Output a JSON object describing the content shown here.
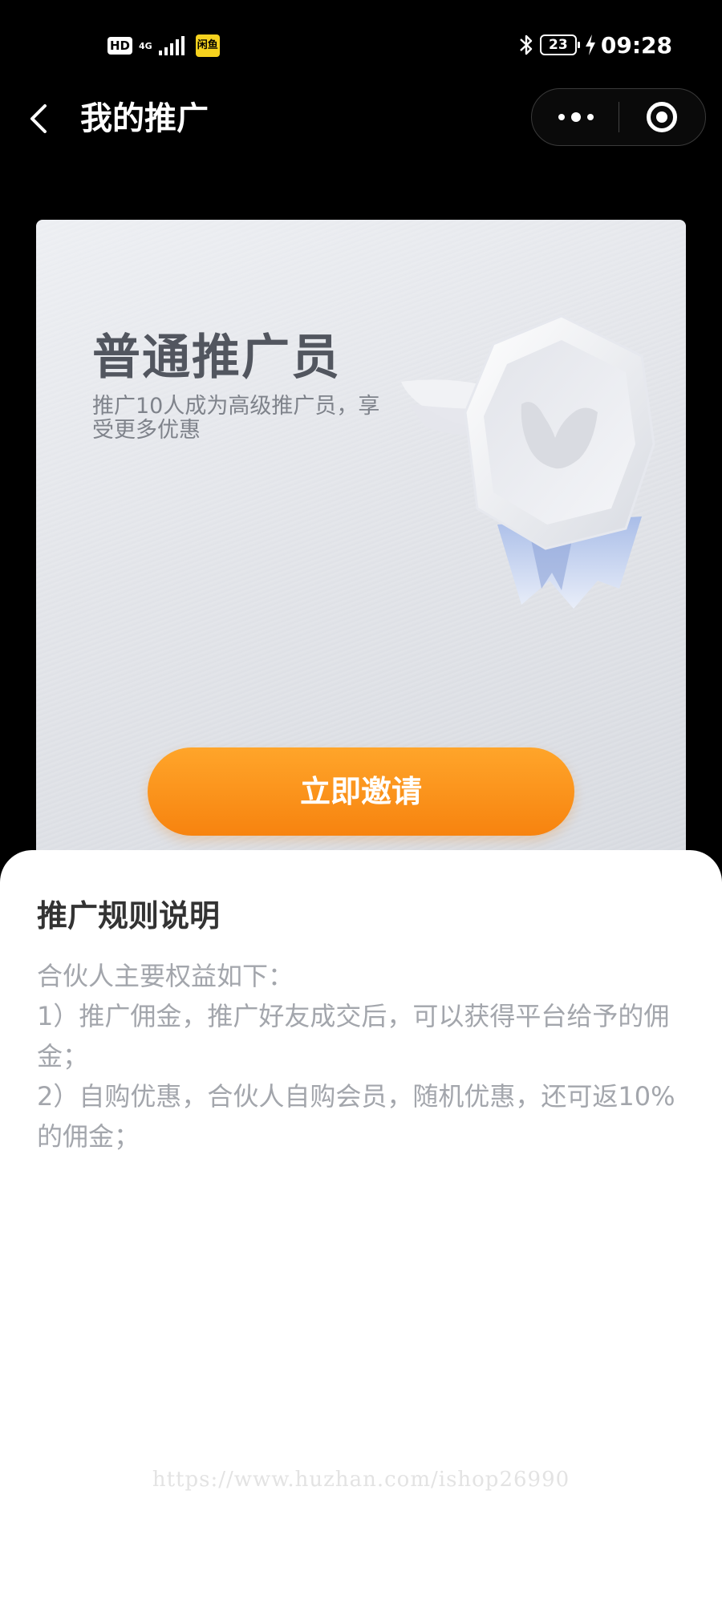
{
  "status_bar": {
    "hd": "HD",
    "network": "4G",
    "app_badge": "闲鱼",
    "battery": "23",
    "time": "09:28"
  },
  "nav": {
    "title": "我的推广"
  },
  "promo": {
    "level_title": "普通推广员",
    "level_desc": "推广10人成为高级推广员，享受更多优惠",
    "invite_label": "立即邀请"
  },
  "rules": {
    "title": "推广规则说明",
    "lines": [
      "合伙人主要权益如下：",
      "1）推广佣金，推广好友成交后，可以获得平台给予的佣金；",
      "2）自购优惠，合伙人自购会员，随机优惠，还可返10%的佣金；"
    ]
  },
  "watermark": "https://www.huzhan.com/ishop26990",
  "colors": {
    "accent_orange": "#f7830f",
    "background": "#000000",
    "sheet": "#ffffff"
  }
}
